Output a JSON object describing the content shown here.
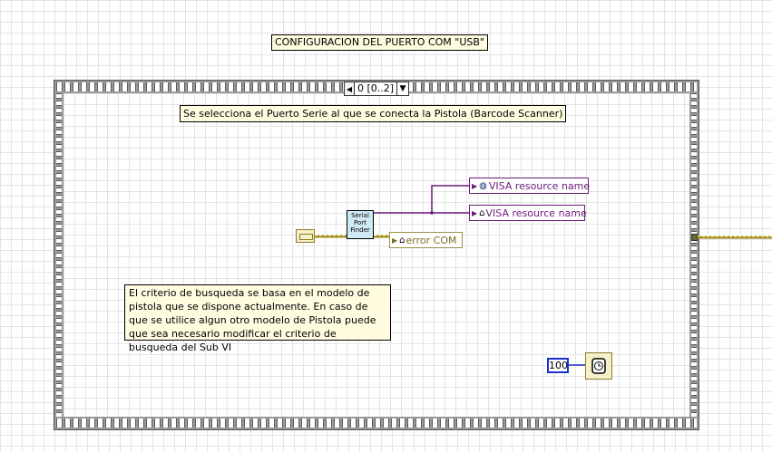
{
  "diagram": {
    "title_label": "CONFIGURACION DEL PUERTO COM \"USB\"",
    "sequence": {
      "selector_value": "0 [0..2]",
      "left_arrow": "◀",
      "right_arrow": "▶",
      "dropdown": "▼"
    },
    "description_label": "Se selecciona el Puerto Serie al que se conecta la Pistola (Barcode Scanner)",
    "subvi": {
      "line1": "Serial",
      "line2": "Port",
      "line3": "Finder",
      "color": "#cfe9f5"
    },
    "indicators": [
      {
        "label": "VISA resource name",
        "icon": "globe-icon",
        "color": "#6b1a7a"
      },
      {
        "label": "VISA resource name",
        "icon": "house-icon",
        "color": "#6b1a7a"
      },
      {
        "label": "error COM",
        "icon": "house-icon",
        "color": "#7a6f25"
      }
    ],
    "comment": "El criterio de busqueda se basa en el modelo de pistola que se dispone actualmente. En caso de que se utilice algun otro modelo de Pistola puede que sea necesario modificar el criterio de busqueda del Sub VI",
    "wait_constant": "100",
    "wait_icon": "wait-ms-icon",
    "wire_colors": {
      "visa": "#6b1a7a",
      "error": "#a08a1c",
      "numeric": "#1a2fd0"
    }
  }
}
